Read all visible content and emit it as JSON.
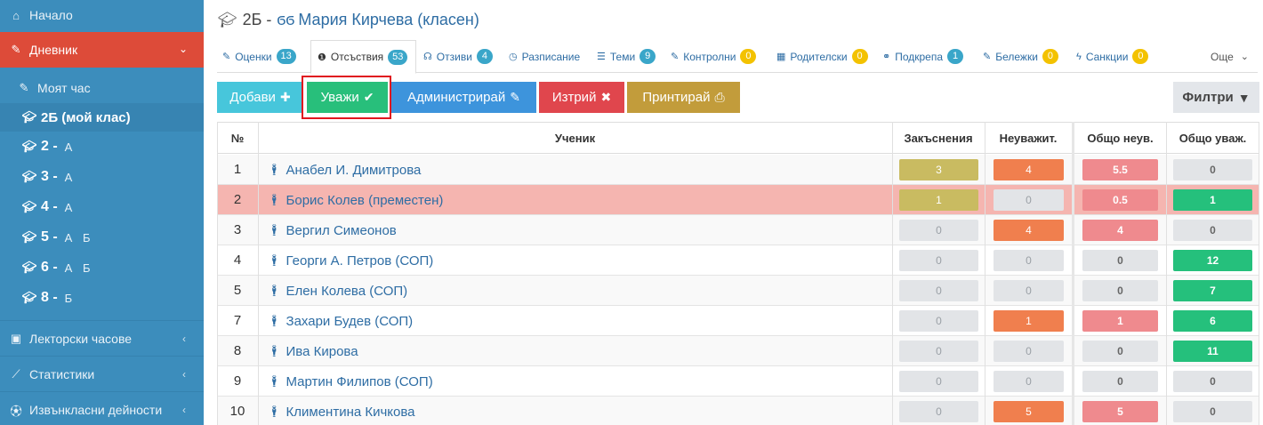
{
  "sidebar": {
    "home": "Начало",
    "journal": "Дневник",
    "my_hour": "Моят час",
    "my_class": "2Б (мой клас)",
    "grades": [
      {
        "grade": "2 -",
        "sections": "А"
      },
      {
        "grade": "3 -",
        "sections": "А"
      },
      {
        "grade": "4 -",
        "sections": "А"
      },
      {
        "grade": "5 -",
        "sections": "А Б"
      },
      {
        "grade": "6 -",
        "sections": "А Б"
      },
      {
        "grade": "8 -",
        "sections": "Б"
      }
    ],
    "lecture_hours": "Лекторски часове",
    "statistics": "Статистики",
    "extracurricular": "Извънкласни дейности"
  },
  "header": {
    "class_prefix": "2Б -",
    "teacher": "Мария Кирчева (класен)"
  },
  "tabs": [
    {
      "label": "Оценки",
      "badge": "13"
    },
    {
      "label": "Отсъствия",
      "badge": "53"
    },
    {
      "label": "Отзиви",
      "badge": "4"
    },
    {
      "label": "Разписание",
      "badge": ""
    },
    {
      "label": "Теми",
      "badge": "9"
    },
    {
      "label": "Контролни",
      "badge": "0"
    },
    {
      "label": "Родителски",
      "badge": "0"
    },
    {
      "label": "Подкрепа",
      "badge": "1"
    },
    {
      "label": "Бележки",
      "badge": "0"
    },
    {
      "label": "Санкции",
      "badge": "0"
    },
    {
      "label": "Още",
      "badge": ""
    }
  ],
  "toolbar": {
    "add": "Добави",
    "excuse": "Уважи",
    "administer": "Администрирай",
    "delete": "Изтрий",
    "print": "Принтирай",
    "filters": "Филтри"
  },
  "table": {
    "headers": {
      "num": "№",
      "student": "Ученик",
      "late": "Закъснения",
      "unexcused": "Неуважит.",
      "total_unexcused": "Общо неув.",
      "total_excused": "Общо уваж."
    },
    "rows": [
      {
        "num": "1",
        "name": "Анабел И. Димитрова",
        "late": "3",
        "unexcused": "4",
        "total_unexcused": "5.5",
        "total_excused": "0"
      },
      {
        "num": "2",
        "name": "Борис Колев (преместен)",
        "late": "1",
        "unexcused": "0",
        "total_unexcused": "0.5",
        "total_excused": "1"
      },
      {
        "num": "3",
        "name": "Вергил Симеонов",
        "late": "0",
        "unexcused": "4",
        "total_unexcused": "4",
        "total_excused": "0"
      },
      {
        "num": "4",
        "name": "Георги А. Петров (СОП)",
        "late": "0",
        "unexcused": "0",
        "total_unexcused": "0",
        "total_excused": "12"
      },
      {
        "num": "5",
        "name": "Елен Колева (СОП)",
        "late": "0",
        "unexcused": "0",
        "total_unexcused": "0",
        "total_excused": "7"
      },
      {
        "num": "7",
        "name": "Захари Будев (СОП)",
        "late": "0",
        "unexcused": "1",
        "total_unexcused": "1",
        "total_excused": "6"
      },
      {
        "num": "8",
        "name": "Ива Кирова",
        "late": "0",
        "unexcused": "0",
        "total_unexcused": "0",
        "total_excused": "11"
      },
      {
        "num": "9",
        "name": "Мартин Филипов (СОП)",
        "late": "0",
        "unexcused": "0",
        "total_unexcused": "0",
        "total_excused": "0"
      },
      {
        "num": "10",
        "name": "Климентина Кичкова",
        "late": "0",
        "unexcused": "5",
        "total_unexcused": "5",
        "total_excused": "0"
      }
    ]
  }
}
